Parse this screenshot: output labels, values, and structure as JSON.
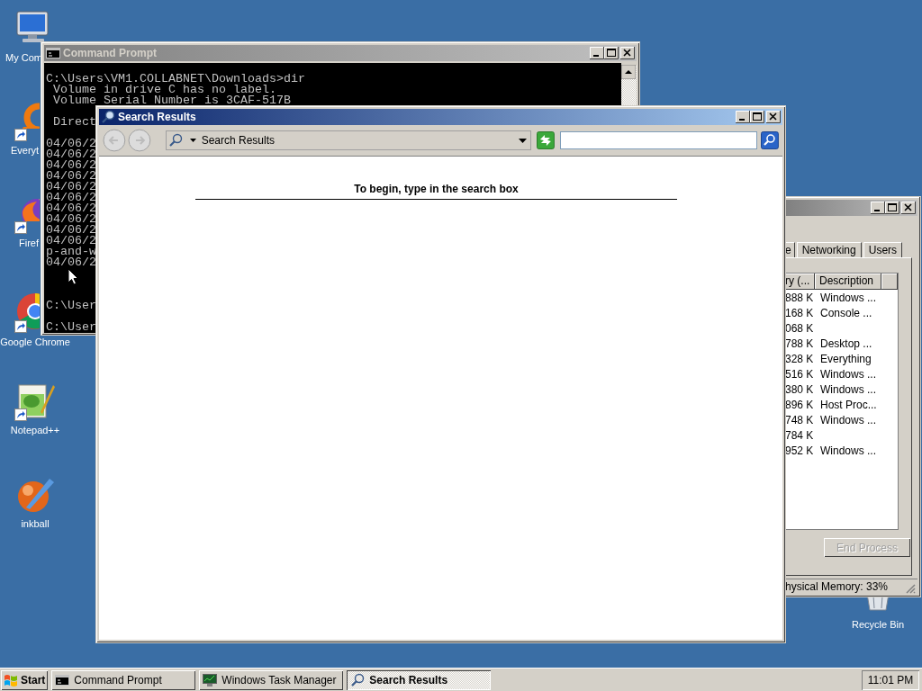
{
  "desktop_icons": [
    {
      "label": "My Com",
      "kind": "computer",
      "shortcut": false
    },
    {
      "label": "Everyt",
      "kind": "ring",
      "shortcut": true
    },
    {
      "label": "Firef",
      "kind": "fox",
      "shortcut": true
    },
    {
      "label": "Google Chrome",
      "kind": "wheel",
      "shortcut": true
    },
    {
      "label": "Notepad++",
      "kind": "notepad",
      "shortcut": true
    },
    {
      "label": "inkball",
      "kind": "ball",
      "shortcut": false
    },
    {
      "label": "Recycle Bin",
      "kind": "bin",
      "shortcut": false
    }
  ],
  "command_prompt": {
    "title": "Command Prompt",
    "active": false,
    "blocks": [
      [
        "C:\\Users\\VM1.COLLABNET\\Downloads>dir",
        " Volume in drive C has no label.",
        " Volume Serial Number is 3CAF-517B"
      ],
      [
        " Direct"
      ],
      [
        "04/06/2",
        "04/06/2",
        "04/06/2",
        "04/06/2",
        "04/06/2",
        "04/06/2",
        "04/06/2",
        "04/06/2",
        "04/06/2",
        "04/06/2",
        "p-and-w",
        "04/06/2"
      ],
      [
        "C:\\User"
      ],
      [
        "C:\\User"
      ]
    ]
  },
  "task_manager": {
    "active": false,
    "tabs": [
      {
        "label": "e",
        "selected": false
      },
      {
        "label": "Networking",
        "selected": false
      },
      {
        "label": "Users",
        "selected": false
      }
    ],
    "columns": [
      "ry (...",
      "Description"
    ],
    "rows": [
      {
        "memory": "888 K",
        "description": "Windows ..."
      },
      {
        "memory": "168 K",
        "description": "Console ..."
      },
      {
        "memory": "068 K"
      },
      {
        "memory": "788 K",
        "description": "Desktop ..."
      },
      {
        "memory": "328 K",
        "description": "Everything"
      },
      {
        "memory": "516 K",
        "description": "Windows ..."
      },
      {
        "memory": "380 K",
        "description": "Windows ..."
      },
      {
        "memory": "896 K",
        "description": "Host Proc..."
      },
      {
        "memory": "748 K",
        "description": "Windows ..."
      },
      {
        "memory": "784 K"
      },
      {
        "memory": "952 K",
        "description": "Windows ..."
      }
    ],
    "end_process": {
      "label": "End Process",
      "disabled": true
    },
    "status": "hysical Memory: 33%"
  },
  "search_results": {
    "title": "Search Results",
    "active": true,
    "address": "Search Results",
    "message": "To begin, type in the search box"
  },
  "taskbar": {
    "start": "Start",
    "buttons": [
      {
        "label": "Command Prompt",
        "kind": "console",
        "selected": false
      },
      {
        "label": "Windows Task Manager",
        "kind": "monitor",
        "selected": false
      },
      {
        "label": "Search Results",
        "kind": "search",
        "selected": true
      }
    ],
    "clock": "11:01 PM"
  }
}
